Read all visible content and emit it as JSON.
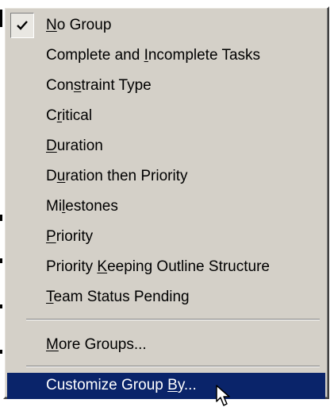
{
  "menu": {
    "items": [
      {
        "pre": "",
        "key": "N",
        "post": "o Group",
        "checked": true
      },
      {
        "pre": "Complete and ",
        "key": "I",
        "post": "ncomplete Tasks"
      },
      {
        "pre": "Con",
        "key": "s",
        "post": "traint Type"
      },
      {
        "pre": "C",
        "key": "r",
        "post": "itical"
      },
      {
        "pre": "",
        "key": "D",
        "post": "uration"
      },
      {
        "pre": "D",
        "key": "u",
        "post": "ration then Priority"
      },
      {
        "pre": "Mi",
        "key": "l",
        "post": "estones"
      },
      {
        "pre": "",
        "key": "P",
        "post": "riority"
      },
      {
        "pre": "Priority ",
        "key": "K",
        "post": "eeping Outline Structure"
      },
      {
        "pre": "",
        "key": "T",
        "post": "eam Status Pending"
      },
      {
        "pre": "",
        "key": "M",
        "post": "ore Groups..."
      },
      {
        "pre": "Customize Group ",
        "key": "B",
        "post": "y...",
        "highlighted": true
      }
    ]
  },
  "colors": {
    "menu_face": "#d4d0c8",
    "highlight": "#0a246a",
    "highlight_text": "#ffffff"
  },
  "icons": {
    "check": "check-icon",
    "cursor": "mouse-pointer-icon"
  }
}
